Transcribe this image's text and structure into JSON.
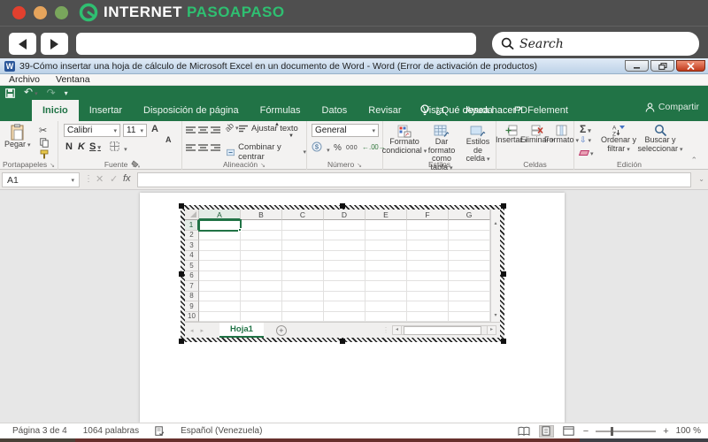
{
  "browser": {
    "logo_white": "INTERNET",
    "logo_green": "PASOAPASO",
    "search_placeholder": "Search"
  },
  "window": {
    "title": "39-Cómo insertar una hoja de cálculo de Microsoft Excel en un documento de Word - Word (Error de activación de productos)",
    "menu_items": [
      "Archivo",
      "Ventana"
    ]
  },
  "ribbon": {
    "tabs": [
      {
        "label": "Inicio",
        "active": true
      },
      {
        "label": "Insertar",
        "active": false
      },
      {
        "label": "Disposición de página",
        "active": false
      },
      {
        "label": "Fórmulas",
        "active": false
      },
      {
        "label": "Datos",
        "active": false
      },
      {
        "label": "Revisar",
        "active": false
      },
      {
        "label": "Vista",
        "active": false
      },
      {
        "label": "Ayuda",
        "active": false
      },
      {
        "label": "PDFelement",
        "active": false
      }
    ],
    "tell_me": "¿Qué desea hacer?",
    "share": "Compartir",
    "paste": "Pegar",
    "font_name": "Calibri",
    "font_size": "11",
    "bold": "N",
    "italic": "K",
    "underline": "S",
    "wrap_text": "Ajustar texto",
    "merge_center": "Combinar y centrar",
    "number_format": "General",
    "percent": "%",
    "thousands": "000",
    "cond_format": "Formato condicional",
    "format_table": "Dar formato como tabla",
    "cell_styles": "Estilos de celda",
    "insert": "Insertar",
    "delete": "Eliminar",
    "format": "Formato",
    "sort_filter": "Ordenar y filtrar",
    "find_select": "Buscar y seleccionar",
    "group_labels": [
      "Portapapeles",
      "Fuente",
      "Alineación",
      "Número",
      "Estilos",
      "Celdas",
      "Edición"
    ]
  },
  "formula_bar": {
    "name_box": "A1",
    "fx": "fx"
  },
  "sheet": {
    "columns": [
      "A",
      "B",
      "C",
      "D",
      "E",
      "F",
      "G"
    ],
    "rows": [
      "1",
      "2",
      "3",
      "4",
      "5",
      "6",
      "7",
      "8",
      "9",
      "10"
    ],
    "active_cell": "A1",
    "tab": "Hoja1"
  },
  "status": {
    "page": "Página 3 de 4",
    "words": "1064 palabras",
    "language": "Español (Venezuela)",
    "zoom": "100 %"
  }
}
